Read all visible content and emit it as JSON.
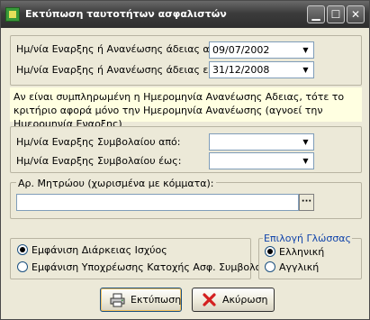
{
  "window": {
    "title": "Εκτύπωση ταυτοτήτων ασφαλιστών",
    "controls": {
      "minimize": "▁",
      "maximize": "☐",
      "close": "✕"
    }
  },
  "license_dates": {
    "from_label": "Ημ/νία Εναρξης ή Ανανέωσης άδειας από:",
    "from_value": "09/07/2002",
    "to_label": "Ημ/νία Εναρξης ή Ανανέωσης άδειας εώς:",
    "to_value": "31/12/2008"
  },
  "note": "Αν είναι συμπληρωμένη η Ημερομηνία Ανανέωσης Αδειας, τότε το κριτήριο αφορά μόνο την Ημερομηνία Ανανέωσης (αγνοεί την Ημερομηνία Εναρξης)",
  "contract_dates": {
    "from_label": "Ημ/νία Εναρξης Συμβολαίου από:",
    "from_value": "",
    "to_label": "Ημ/νία Εναρξης Συμβολαίου έως:",
    "to_value": ""
  },
  "registry": {
    "label": "Αρ. Μητρώου (χωρισμένα με κόμματα):",
    "value": "",
    "browse_label": "···"
  },
  "display_options": {
    "items": [
      {
        "label": "Εμφάνιση Διάρκειας Ισχύος",
        "selected": true
      },
      {
        "label": "Εμφάνιση Υποχρέωσης Κατοχής Ασφ. Συμβολαίου",
        "selected": false
      }
    ]
  },
  "language": {
    "title": "Επιλογή Γλώσσας",
    "items": [
      {
        "label": "Ελληνική",
        "selected": true
      },
      {
        "label": "Αγγλική",
        "selected": false
      }
    ]
  },
  "buttons": {
    "print": "Εκτύπωση",
    "cancel": "Ακύρωση"
  },
  "colors": {
    "titlebar": "#3c3c3c",
    "window_bg": "#ece9d8",
    "note_bg": "#ffffe1",
    "lang_title": "#1144aa",
    "cancel_icon": "#d42020"
  },
  "icons": {
    "app": "app-icon",
    "dropdown": "chevron-down-icon",
    "print": "printer-icon",
    "cancel": "red-x-icon"
  }
}
